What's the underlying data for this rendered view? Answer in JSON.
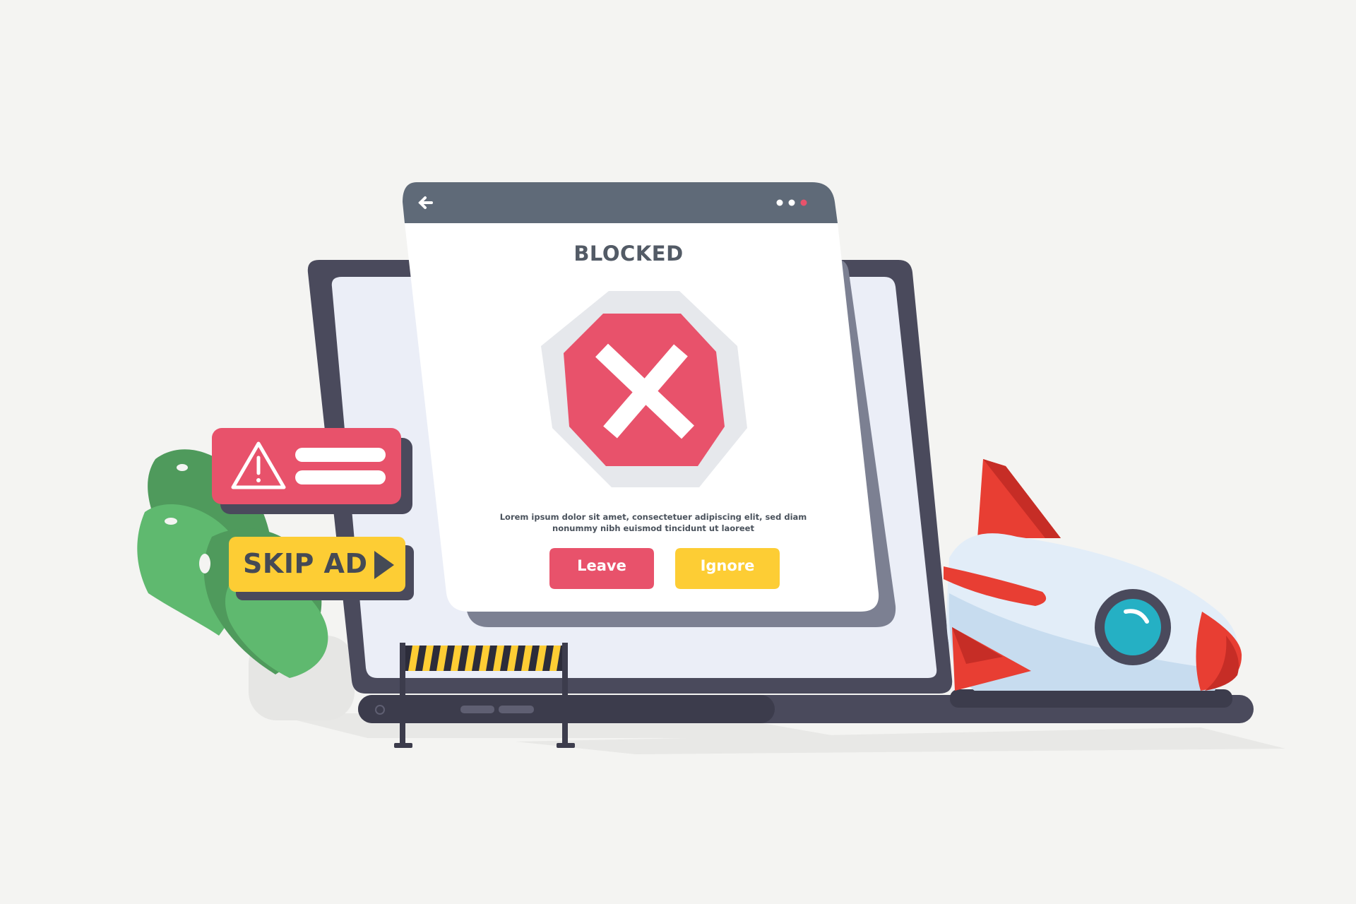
{
  "dialog": {
    "title": "BLOCKED",
    "message": "Lorem ipsum dolor sit amet, consectetuer adipiscing elit, sed diam nonummy nibh euismod tincidunt ut laoreet",
    "leave_label": "Leave",
    "ignore_label": "Ignore",
    "back_icon": "back-arrow-icon",
    "menu_icon": "dots-menu-icon",
    "stop_icon": "stop-x-icon"
  },
  "ad": {
    "skip_label": "SKIP AD",
    "skip_icon": "play-triangle-icon",
    "alert_icon": "warning-triangle-icon"
  },
  "colors": {
    "background": "#f4f4f2",
    "danger": "#e8526b",
    "warning": "#fdcd34",
    "window_bar": "#5f6a78",
    "laptop": "#4a4a5c",
    "plant": "#5fb96f",
    "rocket_red": "#e83e33",
    "rocket_body": "#e2edf8"
  }
}
